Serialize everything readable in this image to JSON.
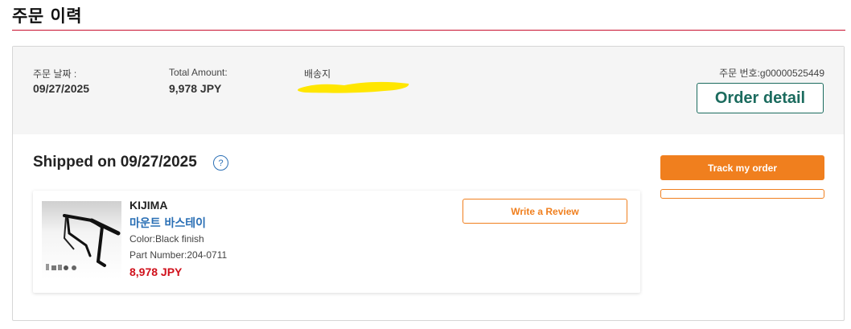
{
  "page": {
    "title": "주문 이력"
  },
  "order": {
    "date_label": "주문 날짜 :",
    "date_value": "09/27/2025",
    "total_label": "Total Amount:",
    "total_value": "9,978 JPY",
    "address_label": "배송지",
    "order_number_label": "주문 번호:",
    "order_number_value": "g00000525449",
    "detail_button": "Order detail"
  },
  "shipment": {
    "title": "Shipped on 09/27/2025",
    "help_icon": "?",
    "track_button": "Track my order"
  },
  "item": {
    "brand": "KIJIMA",
    "name": "마운트 바스테이",
    "color": "Color:Black finish",
    "part_number": "Part Number:204-0711",
    "price": "8,978 JPY",
    "review_button": "Write a Review"
  },
  "colors": {
    "title_rule": "#c8102e",
    "accent_orange": "#f07f1e",
    "detail_green": "#1b6b5e",
    "link_blue": "#2a6fb5",
    "price_red": "#d0101b",
    "address_redaction": "#ffe600"
  }
}
